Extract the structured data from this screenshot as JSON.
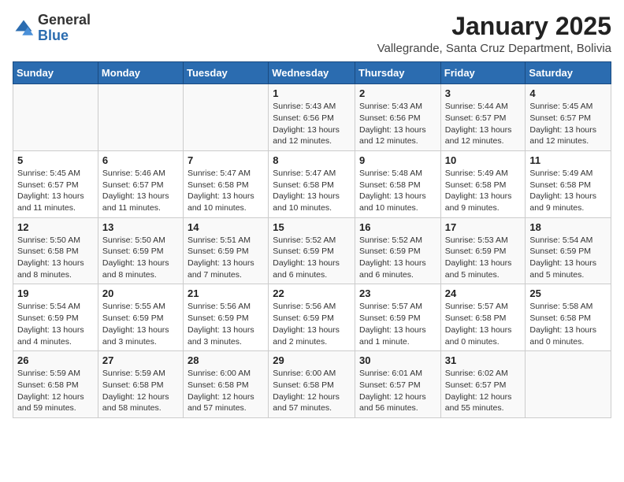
{
  "logo": {
    "general": "General",
    "blue": "Blue"
  },
  "title": "January 2025",
  "location": "Vallegrande, Santa Cruz Department, Bolivia",
  "days_of_week": [
    "Sunday",
    "Monday",
    "Tuesday",
    "Wednesday",
    "Thursday",
    "Friday",
    "Saturday"
  ],
  "weeks": [
    [
      {
        "num": "",
        "info": ""
      },
      {
        "num": "",
        "info": ""
      },
      {
        "num": "",
        "info": ""
      },
      {
        "num": "1",
        "info": "Sunrise: 5:43 AM\nSunset: 6:56 PM\nDaylight: 13 hours and 12 minutes."
      },
      {
        "num": "2",
        "info": "Sunrise: 5:43 AM\nSunset: 6:56 PM\nDaylight: 13 hours and 12 minutes."
      },
      {
        "num": "3",
        "info": "Sunrise: 5:44 AM\nSunset: 6:57 PM\nDaylight: 13 hours and 12 minutes."
      },
      {
        "num": "4",
        "info": "Sunrise: 5:45 AM\nSunset: 6:57 PM\nDaylight: 13 hours and 12 minutes."
      }
    ],
    [
      {
        "num": "5",
        "info": "Sunrise: 5:45 AM\nSunset: 6:57 PM\nDaylight: 13 hours and 11 minutes."
      },
      {
        "num": "6",
        "info": "Sunrise: 5:46 AM\nSunset: 6:57 PM\nDaylight: 13 hours and 11 minutes."
      },
      {
        "num": "7",
        "info": "Sunrise: 5:47 AM\nSunset: 6:58 PM\nDaylight: 13 hours and 10 minutes."
      },
      {
        "num": "8",
        "info": "Sunrise: 5:47 AM\nSunset: 6:58 PM\nDaylight: 13 hours and 10 minutes."
      },
      {
        "num": "9",
        "info": "Sunrise: 5:48 AM\nSunset: 6:58 PM\nDaylight: 13 hours and 10 minutes."
      },
      {
        "num": "10",
        "info": "Sunrise: 5:49 AM\nSunset: 6:58 PM\nDaylight: 13 hours and 9 minutes."
      },
      {
        "num": "11",
        "info": "Sunrise: 5:49 AM\nSunset: 6:58 PM\nDaylight: 13 hours and 9 minutes."
      }
    ],
    [
      {
        "num": "12",
        "info": "Sunrise: 5:50 AM\nSunset: 6:58 PM\nDaylight: 13 hours and 8 minutes."
      },
      {
        "num": "13",
        "info": "Sunrise: 5:50 AM\nSunset: 6:59 PM\nDaylight: 13 hours and 8 minutes."
      },
      {
        "num": "14",
        "info": "Sunrise: 5:51 AM\nSunset: 6:59 PM\nDaylight: 13 hours and 7 minutes."
      },
      {
        "num": "15",
        "info": "Sunrise: 5:52 AM\nSunset: 6:59 PM\nDaylight: 13 hours and 6 minutes."
      },
      {
        "num": "16",
        "info": "Sunrise: 5:52 AM\nSunset: 6:59 PM\nDaylight: 13 hours and 6 minutes."
      },
      {
        "num": "17",
        "info": "Sunrise: 5:53 AM\nSunset: 6:59 PM\nDaylight: 13 hours and 5 minutes."
      },
      {
        "num": "18",
        "info": "Sunrise: 5:54 AM\nSunset: 6:59 PM\nDaylight: 13 hours and 5 minutes."
      }
    ],
    [
      {
        "num": "19",
        "info": "Sunrise: 5:54 AM\nSunset: 6:59 PM\nDaylight: 13 hours and 4 minutes."
      },
      {
        "num": "20",
        "info": "Sunrise: 5:55 AM\nSunset: 6:59 PM\nDaylight: 13 hours and 3 minutes."
      },
      {
        "num": "21",
        "info": "Sunrise: 5:56 AM\nSunset: 6:59 PM\nDaylight: 13 hours and 3 minutes."
      },
      {
        "num": "22",
        "info": "Sunrise: 5:56 AM\nSunset: 6:59 PM\nDaylight: 13 hours and 2 minutes."
      },
      {
        "num": "23",
        "info": "Sunrise: 5:57 AM\nSunset: 6:59 PM\nDaylight: 13 hours and 1 minute."
      },
      {
        "num": "24",
        "info": "Sunrise: 5:57 AM\nSunset: 6:58 PM\nDaylight: 13 hours and 0 minutes."
      },
      {
        "num": "25",
        "info": "Sunrise: 5:58 AM\nSunset: 6:58 PM\nDaylight: 13 hours and 0 minutes."
      }
    ],
    [
      {
        "num": "26",
        "info": "Sunrise: 5:59 AM\nSunset: 6:58 PM\nDaylight: 12 hours and 59 minutes."
      },
      {
        "num": "27",
        "info": "Sunrise: 5:59 AM\nSunset: 6:58 PM\nDaylight: 12 hours and 58 minutes."
      },
      {
        "num": "28",
        "info": "Sunrise: 6:00 AM\nSunset: 6:58 PM\nDaylight: 12 hours and 57 minutes."
      },
      {
        "num": "29",
        "info": "Sunrise: 6:00 AM\nSunset: 6:58 PM\nDaylight: 12 hours and 57 minutes."
      },
      {
        "num": "30",
        "info": "Sunrise: 6:01 AM\nSunset: 6:57 PM\nDaylight: 12 hours and 56 minutes."
      },
      {
        "num": "31",
        "info": "Sunrise: 6:02 AM\nSunset: 6:57 PM\nDaylight: 12 hours and 55 minutes."
      },
      {
        "num": "",
        "info": ""
      }
    ]
  ]
}
